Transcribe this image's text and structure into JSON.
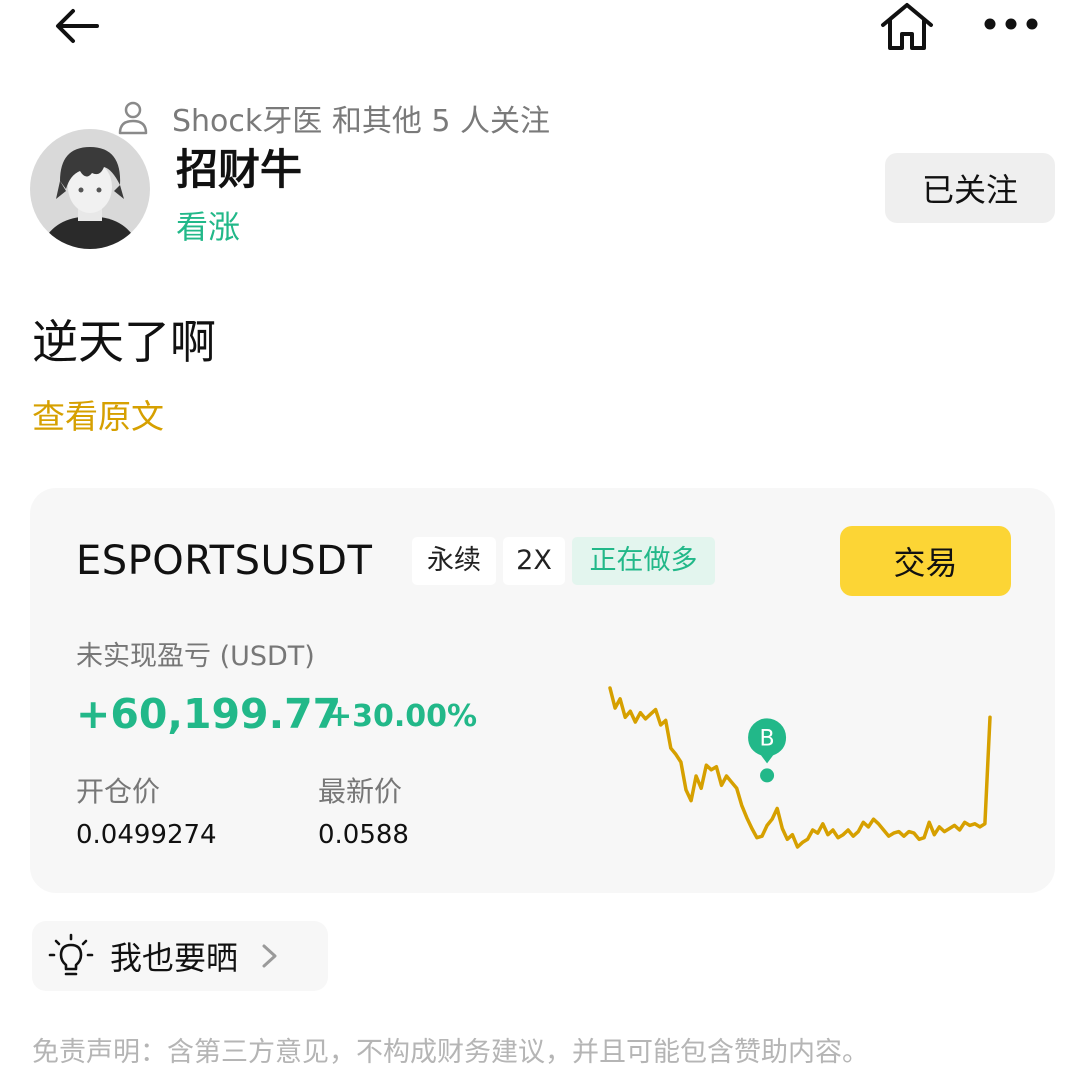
{
  "topbar": {
    "icons": [
      "arrow-left-icon",
      "home-icon",
      "more-icon"
    ]
  },
  "user": {
    "follow_hint": "Shock牙医 和其他 5 人关注",
    "name": "招财牛",
    "sentiment": "看涨",
    "follow_button_label": "已关注"
  },
  "post": {
    "text": "逆天了啊",
    "view_original_label": "查看原文"
  },
  "position_card": {
    "symbol": "ESPORTSUSDT",
    "tags": [
      "永续",
      "2X",
      "正在做多"
    ],
    "trade_button_label": "交易",
    "pnl_label": "未实现盈亏 (USDT)",
    "pnl_value": "+60,199.77",
    "pnl_percent": "+30.00%",
    "open_price_label": "开仓价",
    "open_price_value": "0.0499274",
    "last_price_label": "最新价",
    "last_price_value": "0.0588",
    "marker_label": "B",
    "colors": {
      "line": "#d6a000",
      "profit": "#22b889",
      "trade_button": "#fcd535"
    }
  },
  "chart_data": {
    "type": "line",
    "title": "",
    "xlabel": "",
    "ylabel": "",
    "series": [
      {
        "values": [
          0.0599,
          0.0586,
          0.0592,
          0.058,
          0.0584,
          0.0577,
          0.0583,
          0.0579,
          0.0582,
          0.0585,
          0.0575,
          0.0578,
          0.056,
          0.0556,
          0.0551,
          0.0533,
          0.0526,
          0.0542,
          0.0534,
          0.0549,
          0.0546,
          0.0548,
          0.0536,
          0.0542,
          0.0538,
          0.0534,
          0.0523,
          0.0515,
          0.0508,
          0.0502,
          0.0503,
          0.051,
          0.0514,
          0.0521,
          0.0508,
          0.0501,
          0.0504,
          0.0496,
          0.0499,
          0.0501,
          0.0507,
          0.0505,
          0.0511,
          0.0504,
          0.0507,
          0.0502,
          0.0504,
          0.0507,
          0.0503,
          0.0506,
          0.0512,
          0.0509,
          0.0514,
          0.0511,
          0.0507,
          0.0503,
          0.0505,
          0.0506,
          0.0503,
          0.0506,
          0.0505,
          0.0501,
          0.0502,
          0.0512,
          0.0504,
          0.0509,
          0.0506,
          0.0508,
          0.051,
          0.0507,
          0.0512,
          0.051,
          0.0511,
          0.0509,
          0.0511,
          0.058
        ]
      }
    ],
    "buy_marker_index": 31
  },
  "share": {
    "label": "我也要晒"
  },
  "disclaimer": "免责声明：含第三方意见，不构成财务建议，并且可能包含赞助内容。"
}
